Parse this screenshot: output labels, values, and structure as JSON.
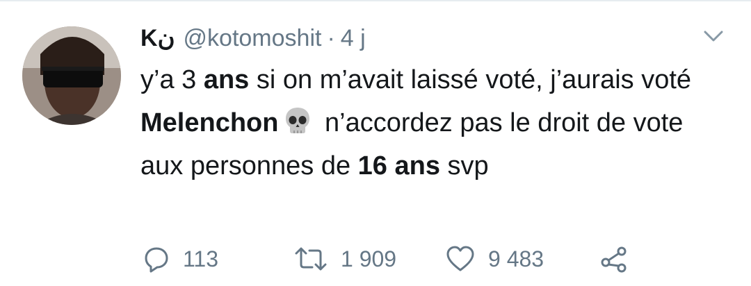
{
  "tweet": {
    "author_name": "Kن",
    "handle": "@kotomoshit",
    "separator": "·",
    "time": "4 j",
    "text_segments": [
      {
        "text": "y’a 3 ",
        "bold": false
      },
      {
        "text": "ans",
        "bold": true
      },
      {
        "text": " si on m’avait laissé voté, j’aurais voté ",
        "bold": false
      },
      {
        "text": "Melenchon",
        "bold": true
      },
      {
        "emoji": "skull-emoji"
      },
      {
        "text": " n’accordez pas le droit de vote aux personnes de ",
        "bold": false
      },
      {
        "text": "16 ans",
        "bold": true
      },
      {
        "text": " svp",
        "bold": false
      }
    ]
  },
  "actions": {
    "reply_count": "113",
    "retweet_count": "1 909",
    "like_count": "9 483"
  },
  "icons": {
    "reply": "reply-icon",
    "retweet": "retweet-icon",
    "like": "heart-icon",
    "share": "share-icon",
    "menu": "chevron-down-icon"
  },
  "colors": {
    "text": "#14171a",
    "secondary": "#657786",
    "divider": "#e6ecf0"
  }
}
